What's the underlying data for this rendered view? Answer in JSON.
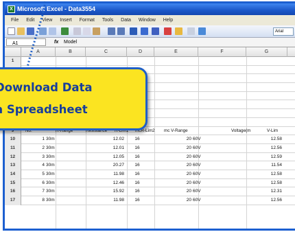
{
  "window": {
    "title": "Microsoft Excel - Data3554"
  },
  "menu": [
    "File",
    "Edit",
    "View",
    "Insert",
    "Format",
    "Tools",
    "Data",
    "Window",
    "Help"
  ],
  "toolbar": {
    "font_name": "Arial"
  },
  "formula_bar": {
    "cell_ref": "A1",
    "fx": "fx",
    "content": "Model"
  },
  "columns": [
    "A",
    "B",
    "C",
    "D",
    "E",
    "F",
    "G"
  ],
  "callout": {
    "line1": "Download Data",
    "line2": "a Spreadsheet"
  },
  "table": {
    "header_row_num": "9",
    "headers": [
      "No.",
      "R-Range",
      "Resistance",
      "R-Lim1",
      "mcR-Lim2",
      "mc V-Range",
      "Voltage(m",
      "V-Lim"
    ],
    "rows": [
      {
        "num": "10",
        "cells": [
          "1",
          "30m",
          "12.02",
          "16",
          "20",
          "60V",
          "12.58"
        ]
      },
      {
        "num": "11",
        "cells": [
          "2",
          "30m",
          "12.01",
          "16",
          "20",
          "60V",
          "12.56"
        ]
      },
      {
        "num": "12",
        "cells": [
          "3",
          "30m",
          "12.05",
          "16",
          "20",
          "60V",
          "12.59"
        ]
      },
      {
        "num": "13",
        "cells": [
          "4",
          "30m",
          "20.27",
          "16",
          "20",
          "60V",
          "11.54"
        ]
      },
      {
        "num": "14",
        "cells": [
          "5",
          "30m",
          "11.98",
          "16",
          "20",
          "60V",
          "12.58"
        ]
      },
      {
        "num": "15",
        "cells": [
          "6",
          "30m",
          "12.46",
          "16",
          "20",
          "60V",
          "12.58"
        ]
      },
      {
        "num": "16",
        "cells": [
          "7",
          "30m",
          "15.92",
          "16",
          "20",
          "60V",
          "12.31"
        ]
      },
      {
        "num": "17",
        "cells": [
          "8",
          "30m",
          "11.98",
          "16",
          "20",
          "60V",
          "12.56"
        ]
      }
    ]
  },
  "colors": {
    "title_bar": "#1a57c8",
    "callout_fill": "#fbe421",
    "callout_text": "#173e9c",
    "frame": "#1c5fd0"
  }
}
